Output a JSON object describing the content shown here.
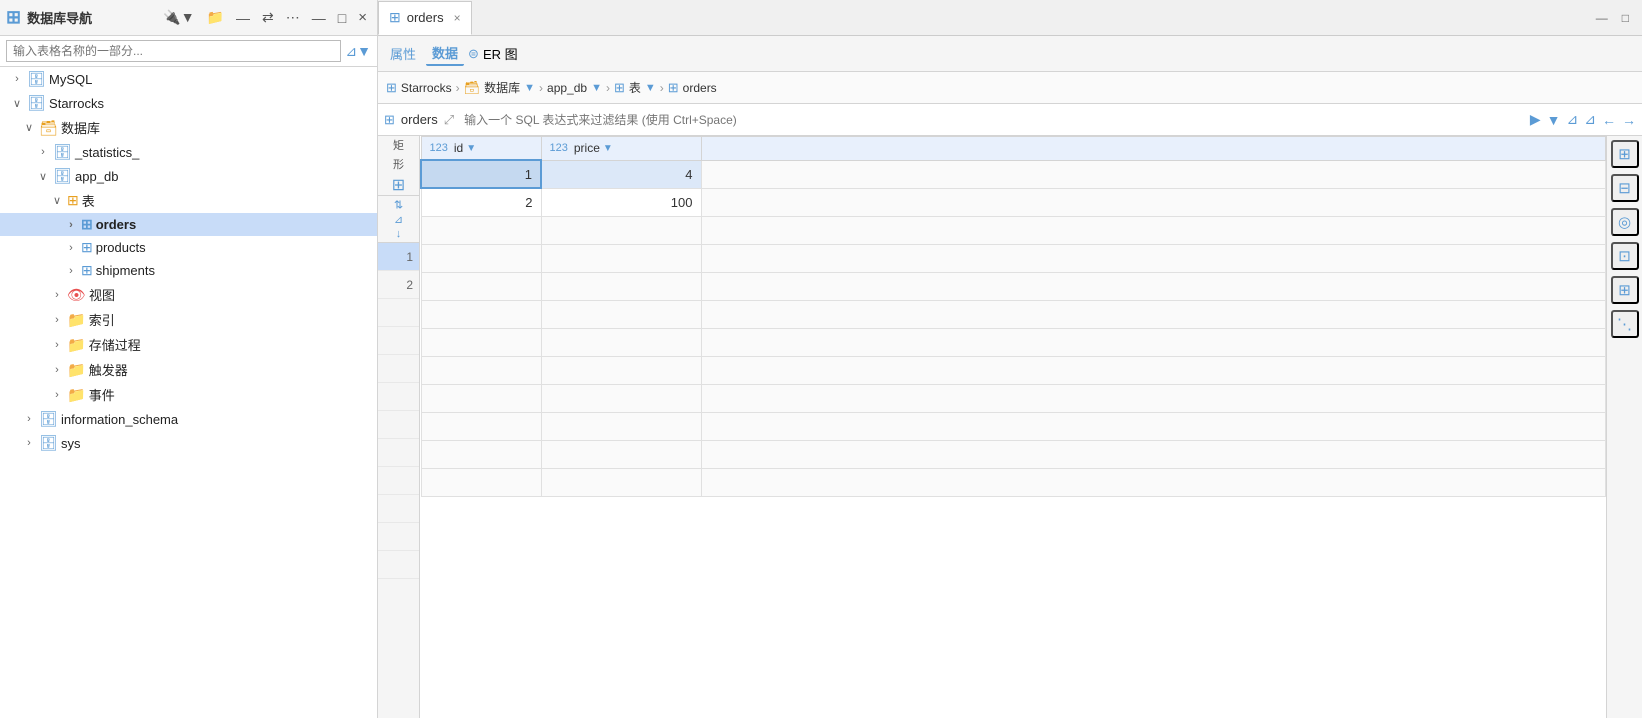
{
  "sidebar": {
    "title": "数据库导航",
    "close_label": "×",
    "search_placeholder": "输入表格名称的一部分...",
    "win_min": "—",
    "win_max": "□",
    "tree": [
      {
        "id": "mysql",
        "level": 0,
        "indent": "indent-1",
        "expand": "›",
        "icon": "🗄️",
        "icon_color": "#5b9bd5",
        "label": "MySQL",
        "selected": false
      },
      {
        "id": "starrocks",
        "level": 0,
        "indent": "indent-1",
        "expand": "∨",
        "icon": "⭐",
        "icon_color": "#5b9bd5",
        "label": "Starrocks",
        "selected": false
      },
      {
        "id": "database_group",
        "level": 1,
        "indent": "indent-2",
        "expand": "∨",
        "icon": "🗃️",
        "icon_color": "#e8a020",
        "label": "数据库",
        "selected": false
      },
      {
        "id": "_statistics_",
        "level": 2,
        "indent": "indent-3",
        "expand": "›",
        "icon": "🗄️",
        "icon_color": "#5b9bd5",
        "label": "_statistics_",
        "selected": false
      },
      {
        "id": "app_db",
        "level": 2,
        "indent": "indent-3",
        "expand": "∨",
        "icon": "🗄️",
        "icon_color": "#5b9bd5",
        "label": "app_db",
        "selected": false
      },
      {
        "id": "tables_group",
        "level": 3,
        "indent": "indent-4",
        "expand": "∨",
        "icon": "⊞",
        "icon_color": "#e8a020",
        "label": "表",
        "selected": false
      },
      {
        "id": "orders",
        "level": 4,
        "indent": "indent-5",
        "expand": "›",
        "icon": "⊞",
        "icon_color": "#5b9bd5",
        "label": "orders",
        "selected": true
      },
      {
        "id": "products",
        "level": 4,
        "indent": "indent-5",
        "expand": "›",
        "icon": "⊞",
        "icon_color": "#5b9bd5",
        "label": "products",
        "selected": false
      },
      {
        "id": "shipments",
        "level": 4,
        "indent": "indent-5",
        "expand": "›",
        "icon": "⊞",
        "icon_color": "#5b9bd5",
        "label": "shipments",
        "selected": false
      },
      {
        "id": "views_group",
        "level": 3,
        "indent": "indent-4",
        "expand": "›",
        "icon": "👁️",
        "icon_color": "#e85050",
        "label": "视图",
        "selected": false
      },
      {
        "id": "indexes_group",
        "level": 3,
        "indent": "indent-4",
        "expand": "›",
        "icon": "📁",
        "icon_color": "#e8a020",
        "label": "索引",
        "selected": false
      },
      {
        "id": "procs_group",
        "level": 3,
        "indent": "indent-4",
        "expand": "›",
        "icon": "📁",
        "icon_color": "#e8a020",
        "label": "存储过程",
        "selected": false
      },
      {
        "id": "triggers_group",
        "level": 3,
        "indent": "indent-4",
        "expand": "›",
        "icon": "📁",
        "icon_color": "#e8a020",
        "label": "触发器",
        "selected": false
      },
      {
        "id": "events_group",
        "level": 3,
        "indent": "indent-4",
        "expand": "›",
        "icon": "📁",
        "icon_color": "#e8a020",
        "label": "事件",
        "selected": false
      },
      {
        "id": "information_schema",
        "level": 1,
        "indent": "indent-2",
        "expand": "›",
        "icon": "🗄️",
        "icon_color": "#5b9bd5",
        "label": "information_schema",
        "selected": false
      },
      {
        "id": "sys",
        "level": 1,
        "indent": "indent-2",
        "expand": "›",
        "icon": "🗄️",
        "icon_color": "#5b9bd5",
        "label": "sys",
        "selected": false
      }
    ]
  },
  "tabs": [
    {
      "id": "orders_tab",
      "label": "orders",
      "icon": "⊞",
      "active": true,
      "closable": true
    }
  ],
  "content_win_min": "—",
  "content_win_max": "□",
  "toolbar": {
    "properties_label": "属性",
    "data_label": "数据",
    "er_label": "ER 图"
  },
  "breadcrumb": {
    "connection_icon": "⊞",
    "connection": "Starrocks",
    "db_icon": "🗃️",
    "db": "数据库",
    "db_dropdown": "▼",
    "schema": "app_db",
    "schema_dropdown": "▼",
    "table_icon": "⊞",
    "table_label": "表",
    "table_dropdown": "▼",
    "current": "orders"
  },
  "sql_bar": {
    "table_icon": "⊞",
    "table_name": "orders",
    "expand_icon": "⤢",
    "placeholder": "输入一个 SQL 表达式来过滤结果 (使用 Ctrl+Space)",
    "run_icon": "▶",
    "dropdown_icon": "▼",
    "filter_icon": "⊿",
    "nav_left": "←",
    "nav_right": "→"
  },
  "grid": {
    "row_header": {
      "line1": "矩",
      "line2": "形",
      "icons": [
        "⊞"
      ]
    },
    "extra_left_icons": [
      "◁▷",
      "⊟",
      "↓"
    ],
    "columns": [
      {
        "name": "id",
        "type": "123",
        "sortable": true
      },
      {
        "name": "price",
        "type": "123",
        "sortable": true
      }
    ],
    "rows": [
      {
        "num": 1,
        "id": "1",
        "price": "4",
        "selected": true
      },
      {
        "num": 2,
        "id": "2",
        "price": "100",
        "selected": false
      }
    ],
    "empty_rows_count": 10
  },
  "right_panel_icons": [
    "⊞",
    "◎",
    "⊟",
    "⊡",
    "⋮⊞"
  ]
}
